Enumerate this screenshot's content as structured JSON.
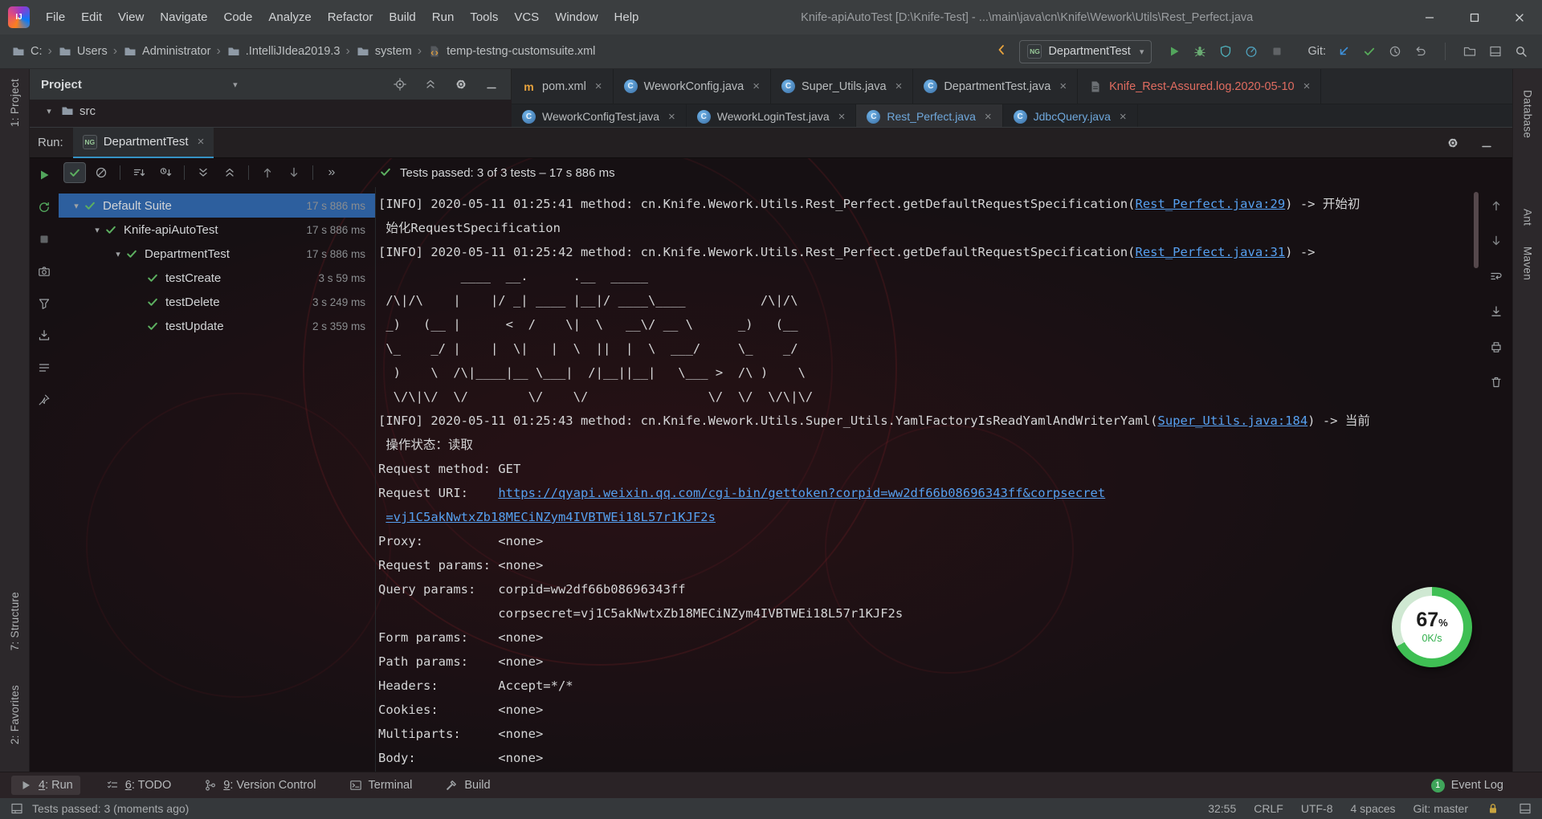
{
  "colors": {
    "accent_blue": "#3d8fd8",
    "test_green": "#57ab5a",
    "link_blue": "#56a0f0",
    "selection_blue": "#2d5f9e",
    "log_tab_red": "#e06c60",
    "progress_green": "#3fbf54"
  },
  "title_bar": {
    "menus": [
      "File",
      "Edit",
      "View",
      "Navigate",
      "Code",
      "Analyze",
      "Refactor",
      "Build",
      "Run",
      "Tools",
      "VCS",
      "Window",
      "Help"
    ],
    "title": "Knife-apiAutoTest [D:\\Knife-Test] - ...\\main\\java\\cn\\Knife\\Wework\\Utils\\Rest_Perfect.java",
    "window_controls": [
      "minimize",
      "maximize",
      "close"
    ]
  },
  "toolbar": {
    "breadcrumbs": [
      "C:",
      "Users",
      "Administrator",
      ".IntelliJIdea2019.3",
      "system",
      "temp-testng-customsuite.xml"
    ],
    "run_config": "DepartmentTest",
    "action_icons": [
      "run",
      "debug",
      "coverage",
      "profiler",
      "stop"
    ],
    "git_label": "Git:",
    "git_icons": [
      "update",
      "commit",
      "history",
      "revert"
    ],
    "far_icons": [
      "explorer",
      "tool-windows",
      "search"
    ]
  },
  "project_panel": {
    "title": "Project",
    "header_icons": [
      "locate",
      "collapse-all",
      "settings",
      "hide"
    ],
    "src_label": "src"
  },
  "left_strip": [
    "1: Project",
    "7: Structure",
    "2: Favorites"
  ],
  "right_strip": [
    "Database",
    "Ant",
    "Maven"
  ],
  "editor_tabs_row1": [
    {
      "label": "pom.xml",
      "icon": "maven"
    },
    {
      "label": "WeworkConfig.java",
      "icon": "class"
    },
    {
      "label": "Super_Utils.java",
      "icon": "class"
    },
    {
      "label": "DepartmentTest.java",
      "icon": "class"
    },
    {
      "label": "Knife_Rest-Assured.log.2020-05-10",
      "icon": "log",
      "color": "#e06c60"
    }
  ],
  "editor_tabs_row2": [
    {
      "label": "WeworkConfigTest.java",
      "icon": "class"
    },
    {
      "label": "WeworkLoginTest.java",
      "icon": "class"
    },
    {
      "label": "Rest_Perfect.java",
      "icon": "class",
      "color": "#6fa8dc",
      "selected": true
    },
    {
      "label": "JdbcQuery.java",
      "icon": "class",
      "color": "#6fa8dc"
    }
  ],
  "run_panel": {
    "tab_label": "Run:",
    "tab_name": "DepartmentTest",
    "left_toolbar": [
      "rerun",
      "rerun-failed",
      "stop",
      "screenshot",
      "filter",
      "import-test-results",
      "test-history",
      "pin"
    ],
    "tree_toolbar": [
      "show-passed",
      "show-ignored",
      "sort-alphabetically",
      "sort-by-duration",
      "expand-all",
      "collapse-all",
      "previous-failed-test",
      "next-failed-test",
      "more"
    ],
    "status": "Tests passed: 3 of 3 tests – 17 s 886 ms",
    "tree": [
      {
        "label": "Default Suite",
        "duration": "17 s 886 ms",
        "indent": 0,
        "expandable": true,
        "selected": true
      },
      {
        "label": "Knife-apiAutoTest",
        "duration": "17 s 886 ms",
        "indent": 1,
        "expandable": true
      },
      {
        "label": "DepartmentTest",
        "duration": "17 s 886 ms",
        "indent": 2,
        "expandable": true
      },
      {
        "label": "testCreate",
        "duration": "3 s 59 ms",
        "indent": 3
      },
      {
        "label": "testDelete",
        "duration": "3 s 249 ms",
        "indent": 3
      },
      {
        "label": "testUpdate",
        "duration": "2 s 359 ms",
        "indent": 3
      }
    ],
    "console_toolbar": [
      "up-stack-trace",
      "down-stack-trace",
      "soft-wrap",
      "scroll-to-end",
      "print",
      "clear-all"
    ]
  },
  "console": {
    "lines": [
      [
        {
          "t": "[INFO] 2020-05-11 01:25:41 method: cn.Knife.Wework.Utils.Rest_Perfect.getDefaultRequestSpecification("
        },
        {
          "t": "Rest_Perfect.java:29",
          "s": "link"
        },
        {
          "t": ") -> 开始初"
        }
      ],
      [
        {
          "t": " 始化RequestSpecification"
        }
      ],
      [
        {
          "t": "[INFO] 2020-05-11 01:25:42 method: cn.Knife.Wework.Utils.Rest_Perfect.getDefaultRequestSpecification("
        },
        {
          "t": "Rest_Perfect.java:31",
          "s": "link"
        },
        {
          "t": ") ->"
        }
      ],
      [
        {
          "t": "           ____  __.      .__  _____"
        }
      ],
      [
        {
          "t": " /\\|/\\    |    |/ _| ____ |__|/ ____\\____          /\\|/\\"
        }
      ],
      [
        {
          "t": " _)   (__ |      <  /    \\|  \\   __\\/ __ \\      _)   (__"
        }
      ],
      [
        {
          "t": " \\_    _/ |    |  \\|   |  \\  ||  |  \\  ___/     \\_    _/"
        }
      ],
      [
        {
          "t": "  )    \\  /\\|____|__ \\___|  /|__||__|   \\___ >  /\\ )    \\"
        }
      ],
      [
        {
          "t": "  \\/\\|\\/  \\/        \\/    \\/                \\/  \\/  \\/\\|\\/"
        }
      ],
      [
        {
          "t": "[INFO] 2020-05-11 01:25:43 method: cn.Knife.Wework.Utils.Super_Utils.YamlFactoryIsReadYamlAndWriterYaml("
        },
        {
          "t": "Super_Utils.java:184",
          "s": "link"
        },
        {
          "t": ") -> 当前"
        }
      ],
      [
        {
          "t": " 操作状态：读取"
        }
      ],
      [
        {
          "t": "Request method: GET"
        }
      ],
      [
        {
          "t": "Request URI:    "
        },
        {
          "t": "https://qyapi.weixin.qq.com/cgi-bin/gettoken?corpid=ww2df66b08696343ff&corpsecret",
          "s": "link"
        }
      ],
      [
        {
          "t": " "
        },
        {
          "t": "=vj1C5akNwtxZb18MECiNZym4IVBTWEi18L57r1KJF2s",
          "s": "link"
        }
      ],
      [
        {
          "t": "Proxy:          <none>"
        }
      ],
      [
        {
          "t": "Request params: <none>"
        }
      ],
      [
        {
          "t": "Query params:   corpid=ww2df66b08696343ff"
        }
      ],
      [
        {
          "t": "                corpsecret=vj1C5akNwtxZb18MECiNZym4IVBTWEi18L57r1KJF2s"
        }
      ],
      [
        {
          "t": "Form params:    <none>"
        }
      ],
      [
        {
          "t": "Path params:    <none>"
        }
      ],
      [
        {
          "t": "Headers:        Accept=*/*"
        }
      ],
      [
        {
          "t": "Cookies:        <none>"
        }
      ],
      [
        {
          "t": "Multiparts:     <none>"
        }
      ],
      [
        {
          "t": "Body:           <none>"
        }
      ]
    ]
  },
  "progress_widget": {
    "percent": "67",
    "unit": "%",
    "speed": "0K/s"
  },
  "bottom_bar": {
    "items": [
      {
        "mnemonic": "4",
        "label": "Run",
        "icon": "run-gray",
        "active": true
      },
      {
        "mnemonic": "6",
        "label": "TODO",
        "icon": "todo"
      },
      {
        "mnemonic": "9",
        "label": "Version Control",
        "icon": "vcs"
      },
      {
        "label": "Terminal",
        "icon": "terminal"
      },
      {
        "label": "Build",
        "icon": "build"
      }
    ],
    "event_log_badge": "1",
    "event_log_label": "Event Log"
  },
  "status_bar": {
    "message": "Tests passed: 3 (moments ago)",
    "items": [
      "32:55",
      "CRLF",
      "UTF-8",
      "4 spaces",
      "Git: master"
    ]
  }
}
